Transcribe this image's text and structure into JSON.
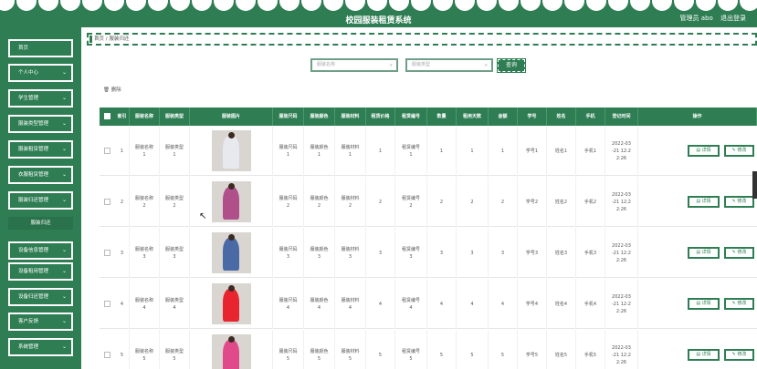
{
  "header": {
    "title": "校园服装租赁系统",
    "admin_label": "管理员 abo",
    "logout": "退出登录"
  },
  "sidebar": {
    "items": [
      {
        "label": "首页",
        "has_chevron": false
      },
      {
        "label": "个人中心",
        "has_chevron": true
      },
      {
        "label": "学生管理",
        "has_chevron": true
      },
      {
        "label": "服装类型管理",
        "has_chevron": true
      },
      {
        "label": "服装租赁管理",
        "has_chevron": true
      },
      {
        "label": "衣服租赁管理",
        "has_chevron": true
      },
      {
        "label": "服装归还管理",
        "has_chevron": true
      },
      {
        "label": "设备信息管理",
        "has_chevron": true
      },
      {
        "label": "设备租用管理",
        "has_chevron": true
      },
      {
        "label": "设备归还管理",
        "has_chevron": true
      },
      {
        "label": "客户反馈",
        "has_chevron": true
      },
      {
        "label": "系统管理",
        "has_chevron": true
      }
    ],
    "submenu_active": "服装归还"
  },
  "breadcrumb": {
    "home": "首页",
    "sep": "/",
    "current": "服装归还"
  },
  "search": {
    "name_placeholder": "服装名称",
    "type_placeholder": "服装类型",
    "button": "查询"
  },
  "toolbar": {
    "delete_label": "删除"
  },
  "table": {
    "columns": [
      "索引",
      "服装名称",
      "服装类型",
      "服装图片",
      "服装尺码",
      "服装颜色",
      "服装材料",
      "租赁价格",
      "租赁编号",
      "数量",
      "租用天数",
      "金额",
      "学号",
      "姓名",
      "手机",
      "登记时间",
      "操作"
    ],
    "rows": [
      {
        "index": "1",
        "name": [
          "服装名称",
          "1"
        ],
        "type": [
          "服装类型",
          "1"
        ],
        "size": [
          "服装尺码",
          "1"
        ],
        "color": [
          "服装颜色",
          "1"
        ],
        "material": [
          "服装材料",
          "1"
        ],
        "price": "1",
        "code": [
          "租赁编号",
          "1"
        ],
        "qty": "1",
        "days": "1",
        "amount": "1",
        "student": "学号1",
        "sname": "姓名1",
        "phone": "手机1",
        "time": [
          "2022-03",
          "-21 12:2",
          "2:26"
        ]
      },
      {
        "index": "2",
        "name": [
          "服装名称",
          "2"
        ],
        "type": [
          "服装类型",
          "2"
        ],
        "size": [
          "服装尺码",
          "2"
        ],
        "color": [
          "服装颜色",
          "2"
        ],
        "material": [
          "服装材料",
          "2"
        ],
        "price": "2",
        "code": [
          "租赁编号",
          "2"
        ],
        "qty": "2",
        "days": "2",
        "amount": "2",
        "student": "学号2",
        "sname": "姓名2",
        "phone": "手机2",
        "time": [
          "2022-03",
          "-21 12:2",
          "2:26"
        ]
      },
      {
        "index": "3",
        "name": [
          "服装名称",
          "3"
        ],
        "type": [
          "服装类型",
          "3"
        ],
        "size": [
          "服装尺码",
          "3"
        ],
        "color": [
          "服装颜色",
          "3"
        ],
        "material": [
          "服装材料",
          "3"
        ],
        "price": "3",
        "code": [
          "租赁编号",
          "3"
        ],
        "qty": "3",
        "days": "3",
        "amount": "3",
        "student": "学号3",
        "sname": "姓名3",
        "phone": "手机3",
        "time": [
          "2022-03",
          "-21 12:2",
          "2:26"
        ]
      },
      {
        "index": "4",
        "name": [
          "服装名称",
          "4"
        ],
        "type": [
          "服装类型",
          "4"
        ],
        "size": [
          "服装尺码",
          "4"
        ],
        "color": [
          "服装颜色",
          "4"
        ],
        "material": [
          "服装材料",
          "4"
        ],
        "price": "4",
        "code": [
          "租赁编号",
          "4"
        ],
        "qty": "4",
        "days": "4",
        "amount": "4",
        "student": "学号4",
        "sname": "姓名4",
        "phone": "手机4",
        "time": [
          "2022-03",
          "-21 12:2",
          "2:26"
        ]
      },
      {
        "index": "5",
        "name": [
          "服装名称",
          "5"
        ],
        "type": [
          "服装类型",
          "5"
        ],
        "size": [
          "服装尺码",
          "5"
        ],
        "color": [
          "服装颜色",
          "5"
        ],
        "material": [
          "服装材料",
          "5"
        ],
        "price": "5",
        "code": [
          "租赁编号",
          "5"
        ],
        "qty": "5",
        "days": "5",
        "amount": "5",
        "student": "学号5",
        "sname": "姓名5",
        "phone": "手机5",
        "time": [
          "2022-03",
          "-21 12:2",
          "2:26"
        ]
      }
    ],
    "detail_label": "详情",
    "edit_label": "修改"
  },
  "colors": {
    "primary": "#2e7d53",
    "background": "#ffffff",
    "costume_colors": [
      "#e8e8ef",
      "#b0508a",
      "#4a6aa5",
      "#e8242e",
      "#e04a8a"
    ]
  }
}
